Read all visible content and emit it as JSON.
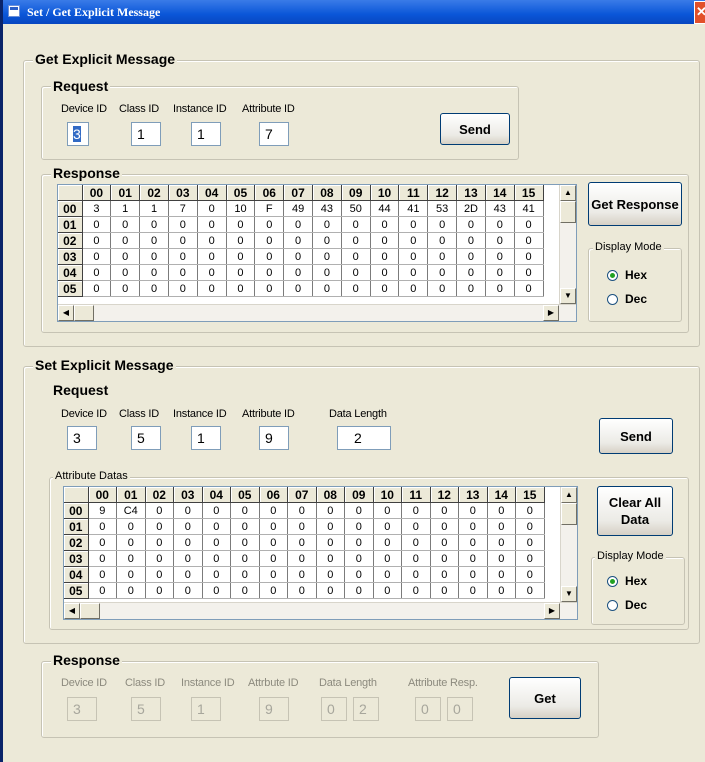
{
  "window": {
    "title": "Set / Get Explicit Message",
    "close_glyph": "✕"
  },
  "get_section": {
    "title": "Get Explicit Message",
    "request": {
      "title": "Request",
      "device_id_label": "Device ID",
      "device_id": "3",
      "class_id_label": "Class ID",
      "class_id": "1",
      "instance_id_label": "Instance ID",
      "instance_id": "1",
      "attribute_id_label": "Attribute ID",
      "attribute_id": "7",
      "send_label": "Send"
    },
    "response": {
      "title": "Response",
      "columns": [
        "00",
        "01",
        "02",
        "03",
        "04",
        "05",
        "06",
        "07",
        "08",
        "09",
        "10",
        "11",
        "12",
        "13",
        "14",
        "15"
      ],
      "rows": [
        {
          "label": "00",
          "cells": [
            "3",
            "1",
            "1",
            "7",
            "0",
            "10",
            "F",
            "49",
            "43",
            "50",
            "44",
            "41",
            "53",
            "2D",
            "43",
            "41"
          ]
        },
        {
          "label": "01",
          "cells": [
            "0",
            "0",
            "0",
            "0",
            "0",
            "0",
            "0",
            "0",
            "0",
            "0",
            "0",
            "0",
            "0",
            "0",
            "0",
            "0"
          ]
        },
        {
          "label": "02",
          "cells": [
            "0",
            "0",
            "0",
            "0",
            "0",
            "0",
            "0",
            "0",
            "0",
            "0",
            "0",
            "0",
            "0",
            "0",
            "0",
            "0"
          ]
        },
        {
          "label": "03",
          "cells": [
            "0",
            "0",
            "0",
            "0",
            "0",
            "0",
            "0",
            "0",
            "0",
            "0",
            "0",
            "0",
            "0",
            "0",
            "0",
            "0"
          ]
        },
        {
          "label": "04",
          "cells": [
            "0",
            "0",
            "0",
            "0",
            "0",
            "0",
            "0",
            "0",
            "0",
            "0",
            "0",
            "0",
            "0",
            "0",
            "0",
            "0"
          ]
        },
        {
          "label": "05",
          "cells": [
            "0",
            "0",
            "0",
            "0",
            "0",
            "0",
            "0",
            "0",
            "0",
            "0",
            "0",
            "0",
            "0",
            "0",
            "0",
            "0"
          ]
        }
      ],
      "get_response_label": "Get Response",
      "display_mode_label": "Display Mode",
      "hex_label": "Hex",
      "dec_label": "Dec",
      "selected_mode": "Hex"
    }
  },
  "set_section": {
    "title": "Set Explicit Message",
    "request": {
      "title": "Request",
      "device_id_label": "Device ID",
      "device_id": "3",
      "class_id_label": "Class ID",
      "class_id": "5",
      "instance_id_label": "Instance ID",
      "instance_id": "1",
      "attribute_id_label": "Attribute ID",
      "attribute_id": "9",
      "data_length_label": "Data Length",
      "data_length": "2",
      "send_label": "Send"
    },
    "attribute_datas": {
      "title": "Attribute Datas",
      "columns": [
        "00",
        "01",
        "02",
        "03",
        "04",
        "05",
        "06",
        "07",
        "08",
        "09",
        "10",
        "11",
        "12",
        "13",
        "14",
        "15"
      ],
      "rows": [
        {
          "label": "00",
          "cells": [
            "9",
            "C4",
            "0",
            "0",
            "0",
            "0",
            "0",
            "0",
            "0",
            "0",
            "0",
            "0",
            "0",
            "0",
            "0",
            "0"
          ]
        },
        {
          "label": "01",
          "cells": [
            "0",
            "0",
            "0",
            "0",
            "0",
            "0",
            "0",
            "0",
            "0",
            "0",
            "0",
            "0",
            "0",
            "0",
            "0",
            "0"
          ]
        },
        {
          "label": "02",
          "cells": [
            "0",
            "0",
            "0",
            "0",
            "0",
            "0",
            "0",
            "0",
            "0",
            "0",
            "0",
            "0",
            "0",
            "0",
            "0",
            "0"
          ]
        },
        {
          "label": "03",
          "cells": [
            "0",
            "0",
            "0",
            "0",
            "0",
            "0",
            "0",
            "0",
            "0",
            "0",
            "0",
            "0",
            "0",
            "0",
            "0",
            "0"
          ]
        },
        {
          "label": "04",
          "cells": [
            "0",
            "0",
            "0",
            "0",
            "0",
            "0",
            "0",
            "0",
            "0",
            "0",
            "0",
            "0",
            "0",
            "0",
            "0",
            "0"
          ]
        },
        {
          "label": "05",
          "cells": [
            "0",
            "0",
            "0",
            "0",
            "0",
            "0",
            "0",
            "0",
            "0",
            "0",
            "0",
            "0",
            "0",
            "0",
            "0",
            "0"
          ]
        }
      ],
      "clear_all_label": "Clear All Data",
      "display_mode_label": "Display Mode",
      "hex_label": "Hex",
      "dec_label": "Dec",
      "selected_mode": "Hex"
    },
    "response": {
      "title": "Response",
      "device_id_label": "Device ID",
      "device_id": "3",
      "class_id_label": "Class ID",
      "class_id": "5",
      "instance_id_label": "Instance ID",
      "instance_id": "1",
      "attribute_id_label": "Attrbute ID",
      "attribute_id": "9",
      "data_length_label": "Data Length",
      "data_length_hi": "0",
      "data_length_lo": "2",
      "attribute_resp_label": "Attribute Resp.",
      "attribute_resp_hi": "0",
      "attribute_resp_lo": "0",
      "get_label": "Get"
    }
  }
}
